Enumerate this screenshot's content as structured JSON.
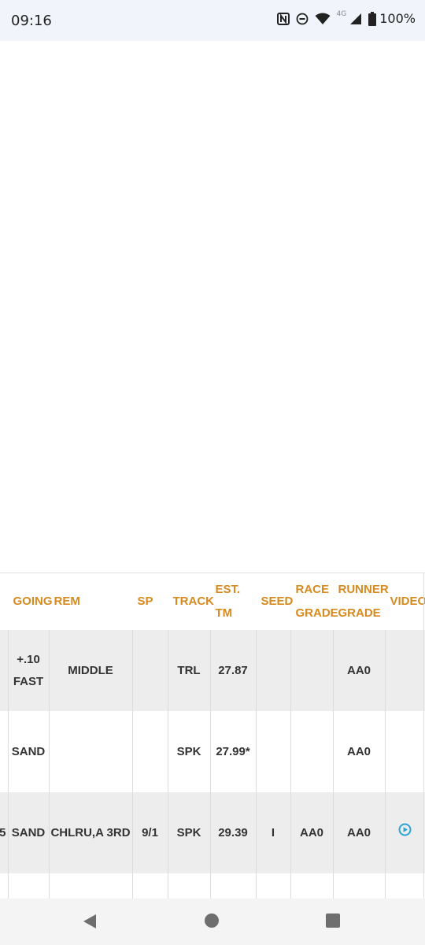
{
  "status_bar": {
    "time": "09:16",
    "network_label": "4G",
    "battery_percent": "100%",
    "icons": [
      "nfc-icon",
      "do-not-disturb-icon",
      "wifi-icon",
      "cell-signal-icon",
      "battery-icon"
    ]
  },
  "table": {
    "headers": {
      "going": "GOING",
      "rem": "REM",
      "sp": "SP",
      "track": "TRACK",
      "est_tm": "EST. TM",
      "seed": "SEED",
      "race_grade": "RACE GRADE",
      "runner_grade": "RUNNER GRADE",
      "video": "VIDEO"
    },
    "rows": [
      {
        "cut": "",
        "going": "+.10 FAST",
        "rem": "MIDDLE",
        "sp": "",
        "track": "TRL",
        "est_tm": "27.87",
        "seed": "",
        "race_grade": "",
        "runner_grade": "AA0",
        "video": ""
      },
      {
        "cut": "",
        "going": "SAND",
        "rem": "",
        "sp": "",
        "track": "SPK",
        "est_tm": "27.99*",
        "seed": "",
        "race_grade": "",
        "runner_grade": "AA0",
        "video": ""
      },
      {
        "cut": "5",
        "going": "SAND",
        "rem": "CHLRU,A 3RD",
        "sp": "9/1",
        "track": "SPK",
        "est_tm": "29.39",
        "seed": "I",
        "race_grade": "AA0",
        "runner_grade": "AA0",
        "video": "play-icon"
      }
    ]
  },
  "colors": {
    "header_text": "#d68a1f",
    "row_shade": "#ededed",
    "video_icon": "#2aa3d6",
    "status_bar_bg": "#f1f4fa"
  },
  "nav_bar": {
    "icons": [
      "back-icon",
      "home-icon",
      "recents-icon"
    ]
  }
}
